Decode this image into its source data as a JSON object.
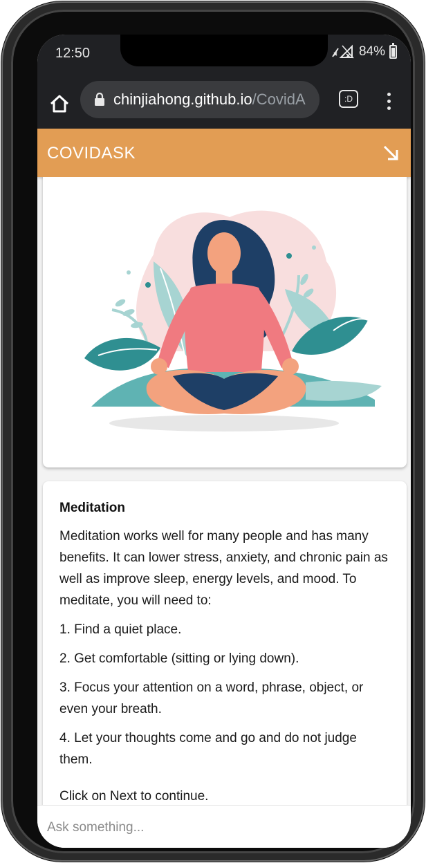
{
  "status_bar": {
    "time": "12:50",
    "battery": "84%",
    "battery_level": 0.84
  },
  "browser": {
    "url_host": "chinjiahong.github.io",
    "url_path": "/CovidA",
    "home_icon": "home-icon",
    "lock_icon": "lock-icon",
    "tab_label": ":D",
    "menu_icon": "more-vert-icon"
  },
  "app": {
    "title": "COVIDASK",
    "accent_color": "#e29d54",
    "collapse_icon": "arrow-down-right-icon"
  },
  "image_card": {
    "illustration": "meditation-illustration"
  },
  "card": {
    "heading": "Meditation",
    "paragraphs": [
      "Meditation works well for many people and has many benefits. It can lower stress, anxiety, and chronic pain as well as improve sleep, energy levels, and mood. To meditate, you will need to:",
      "1. Find a quiet place.",
      "2. Get comfortable (sitting or lying down).",
      "3. Focus your attention on a word, phrase, object, or even your breath.",
      "4. Let your thoughts come and go and do not judge them.",
      "Click on Next to continue."
    ]
  },
  "input": {
    "placeholder": "Ask something..."
  }
}
